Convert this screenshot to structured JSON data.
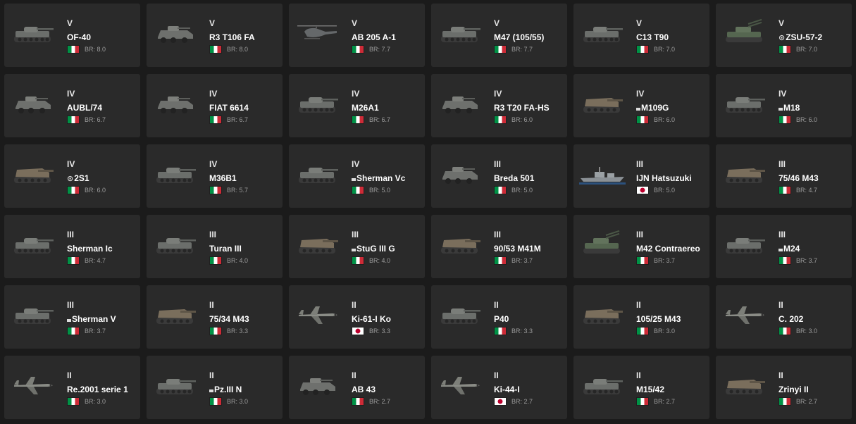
{
  "vehicles": [
    {
      "rank": "V",
      "name": "OF-40",
      "prefix": "",
      "flag": "italy",
      "br": "BR: 8.0",
      "icon": "tank-icon"
    },
    {
      "rank": "V",
      "name": "R3 T106 FA",
      "prefix": "",
      "flag": "italy",
      "br": "BR: 8.0",
      "icon": "armored-car-icon"
    },
    {
      "rank": "V",
      "name": "AB 205 A-1",
      "prefix": "",
      "flag": "italy",
      "br": "BR: 7.7",
      "icon": "helicopter-icon"
    },
    {
      "rank": "V",
      "name": "M47 (105/55)",
      "prefix": "",
      "flag": "italy",
      "br": "BR: 7.7",
      "icon": "tank-icon"
    },
    {
      "rank": "V",
      "name": "C13 T90",
      "prefix": "",
      "flag": "italy",
      "br": "BR: 7.0",
      "icon": "tank-icon"
    },
    {
      "rank": "V",
      "name": "ZSU-57-2",
      "prefix": "⊙",
      "flag": "italy",
      "br": "BR: 7.0",
      "icon": "spaa-icon"
    },
    {
      "rank": "IV",
      "name": "AUBL/74",
      "prefix": "",
      "flag": "italy",
      "br": "BR: 6.7",
      "icon": "armored-car-icon"
    },
    {
      "rank": "IV",
      "name": "FIAT 6614",
      "prefix": "",
      "flag": "italy",
      "br": "BR: 6.7",
      "icon": "armored-car-icon"
    },
    {
      "rank": "IV",
      "name": "M26A1",
      "prefix": "",
      "flag": "italy",
      "br": "BR: 6.7",
      "icon": "tank-icon"
    },
    {
      "rank": "IV",
      "name": "R3 T20 FA-HS",
      "prefix": "",
      "flag": "italy",
      "br": "BR: 6.0",
      "icon": "armored-car-icon"
    },
    {
      "rank": "IV",
      "name": "M109G",
      "prefix": "box",
      "flag": "italy",
      "br": "BR: 6.0",
      "icon": "spg-icon"
    },
    {
      "rank": "IV",
      "name": "M18",
      "prefix": "box",
      "flag": "italy",
      "br": "BR: 6.0",
      "icon": "tank-icon"
    },
    {
      "rank": "IV",
      "name": "2S1",
      "prefix": "⊙",
      "flag": "italy",
      "br": "BR: 6.0",
      "icon": "spg-icon"
    },
    {
      "rank": "IV",
      "name": "M36B1",
      "prefix": "",
      "flag": "italy",
      "br": "BR: 5.7",
      "icon": "tank-icon"
    },
    {
      "rank": "IV",
      "name": "Sherman Vc",
      "prefix": "box",
      "flag": "italy",
      "br": "BR: 5.0",
      "icon": "tank-icon"
    },
    {
      "rank": "III",
      "name": "Breda 501",
      "prefix": "",
      "flag": "italy",
      "br": "BR: 5.0",
      "icon": "armored-car-icon"
    },
    {
      "rank": "III",
      "name": "IJN Hatsuzuki",
      "prefix": "",
      "flag": "japan",
      "br": "BR: 5.0",
      "icon": "ship-icon"
    },
    {
      "rank": "III",
      "name": "75/46 M43",
      "prefix": "",
      "flag": "italy",
      "br": "BR: 4.7",
      "icon": "spg-icon"
    },
    {
      "rank": "III",
      "name": "Sherman Ic",
      "prefix": "",
      "flag": "italy",
      "br": "BR: 4.7",
      "icon": "tank-icon"
    },
    {
      "rank": "III",
      "name": "Turan III",
      "prefix": "",
      "flag": "italy",
      "br": "BR: 4.0",
      "icon": "tank-icon"
    },
    {
      "rank": "III",
      "name": "StuG III G",
      "prefix": "box",
      "flag": "italy",
      "br": "BR: 4.0",
      "icon": "spg-icon"
    },
    {
      "rank": "III",
      "name": "90/53 M41M",
      "prefix": "",
      "flag": "italy",
      "br": "BR: 3.7",
      "icon": "spg-icon"
    },
    {
      "rank": "III",
      "name": "M42 Contraereo",
      "prefix": "",
      "flag": "italy",
      "br": "BR: 3.7",
      "icon": "spaa-icon"
    },
    {
      "rank": "III",
      "name": "M24",
      "prefix": "box",
      "flag": "italy",
      "br": "BR: 3.7",
      "icon": "tank-icon"
    },
    {
      "rank": "III",
      "name": "Sherman V",
      "prefix": "box",
      "flag": "italy",
      "br": "BR: 3.7",
      "icon": "tank-icon"
    },
    {
      "rank": "II",
      "name": "75/34 M43",
      "prefix": "",
      "flag": "italy",
      "br": "BR: 3.3",
      "icon": "spg-icon"
    },
    {
      "rank": "II",
      "name": "Ki-61-I Ko",
      "prefix": "",
      "flag": "japan",
      "br": "BR: 3.3",
      "icon": "plane-icon"
    },
    {
      "rank": "II",
      "name": "P40",
      "prefix": "",
      "flag": "italy",
      "br": "BR: 3.3",
      "icon": "tank-icon"
    },
    {
      "rank": "II",
      "name": "105/25 M43",
      "prefix": "",
      "flag": "italy",
      "br": "BR: 3.0",
      "icon": "spg-icon"
    },
    {
      "rank": "II",
      "name": "C. 202",
      "prefix": "",
      "flag": "italy",
      "br": "BR: 3.0",
      "icon": "plane-icon"
    },
    {
      "rank": "II",
      "name": "Re.2001 serie 1",
      "prefix": "",
      "flag": "italy",
      "br": "BR: 3.0",
      "icon": "plane-icon"
    },
    {
      "rank": "II",
      "name": "Pz.III N",
      "prefix": "box",
      "flag": "italy",
      "br": "BR: 3.0",
      "icon": "tank-icon"
    },
    {
      "rank": "II",
      "name": "AB 43",
      "prefix": "",
      "flag": "italy",
      "br": "BR: 2.7",
      "icon": "armored-car-icon"
    },
    {
      "rank": "II",
      "name": "Ki-44-I",
      "prefix": "",
      "flag": "japan",
      "br": "BR: 2.7",
      "icon": "plane-icon"
    },
    {
      "rank": "II",
      "name": "M15/42",
      "prefix": "",
      "flag": "italy",
      "br": "BR: 2.7",
      "icon": "tank-icon"
    },
    {
      "rank": "II",
      "name": "Zrinyi II",
      "prefix": "",
      "flag": "italy",
      "br": "BR: 2.7",
      "icon": "spg-icon"
    }
  ]
}
